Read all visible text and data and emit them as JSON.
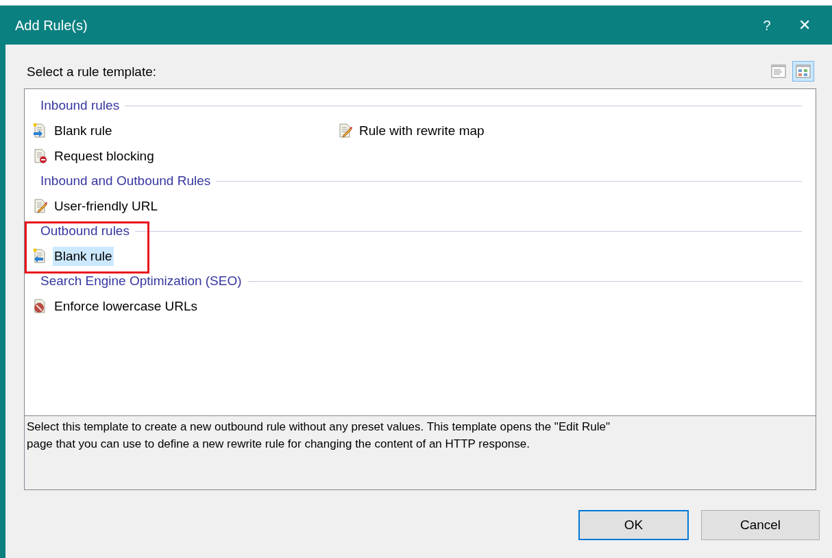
{
  "window": {
    "title": "Add Rule(s)",
    "help": "?",
    "close": "✕"
  },
  "prompt": "Select a rule template:",
  "view_buttons": [
    {
      "kind": "details",
      "selected": false
    },
    {
      "kind": "tiles",
      "selected": true
    }
  ],
  "groups": [
    {
      "title": "Inbound rules",
      "annotated": false,
      "items": [
        {
          "label": "Blank rule",
          "kind": "new-inbound",
          "selected": false
        },
        {
          "label": "Rule with rewrite map",
          "kind": "edit",
          "selected": false
        },
        {
          "label": "Request blocking",
          "kind": "block",
          "selected": false
        }
      ]
    },
    {
      "title": "Inbound and Outbound Rules",
      "annotated": false,
      "items": [
        {
          "label": "User-friendly URL",
          "kind": "edit",
          "selected": false
        }
      ]
    },
    {
      "title": "Outbound rules",
      "annotated": true,
      "items": [
        {
          "label": "Blank rule",
          "kind": "new-outbound",
          "selected": true
        }
      ]
    },
    {
      "title": "Search Engine Optimization (SEO)",
      "annotated": false,
      "items": [
        {
          "label": "Enforce lowercase URLs",
          "kind": "seo",
          "selected": false
        }
      ]
    }
  ],
  "description": "Select this template to create a new outbound rule without any preset values. This template opens the \"Edit Rule\" page that you can use to define a new rewrite rule for changing the content of an HTTP response.",
  "buttons": [
    {
      "label": "OK",
      "default": true
    },
    {
      "label": "Cancel",
      "default": false
    }
  ]
}
